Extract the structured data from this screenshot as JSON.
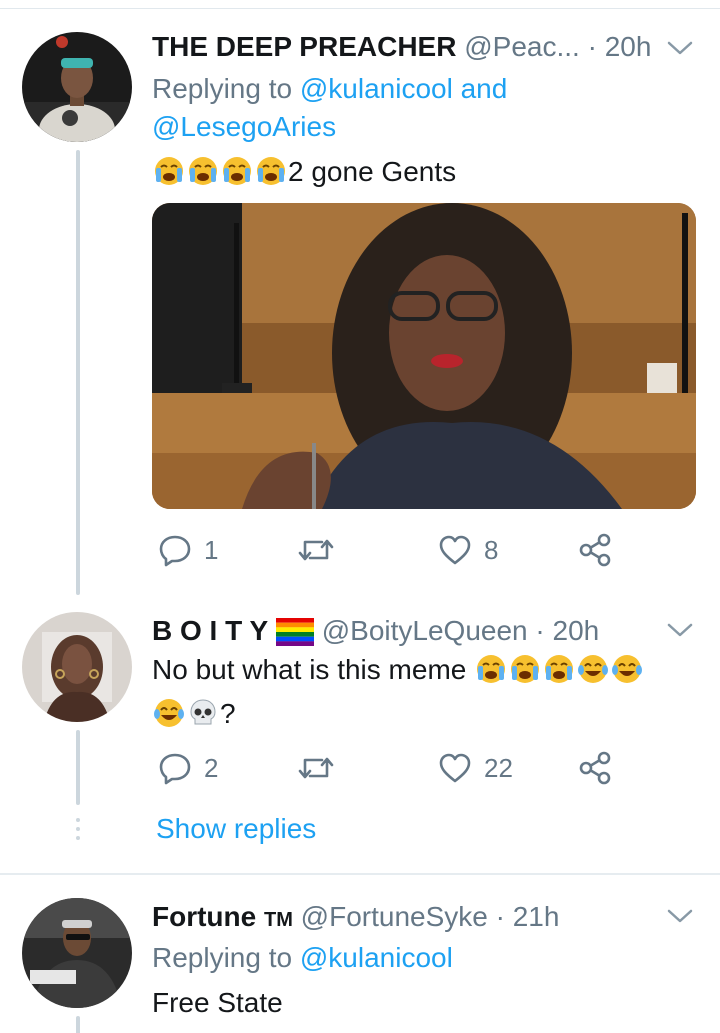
{
  "tweets": [
    {
      "name": "THE DEEP PREACHER",
      "handle": "@Peac...",
      "time": "· 20h",
      "reply_prefix": "Replying to ",
      "reply_mention_1": "@kulanicool",
      "reply_and": " and",
      "reply_mention_2": "@LesegoAries",
      "text": "2 gone Gents",
      "emojis": [
        "loudly-crying-face",
        "loudly-crying-face",
        "loudly-crying-face",
        "loudly-crying-face"
      ],
      "actions": {
        "replies": "1",
        "retweets": "",
        "likes": "8"
      }
    },
    {
      "name": "B O I T Y",
      "name_emoji": "rainbow-flag",
      "handle": "@BoityLeQueen",
      "time": "· 20h",
      "text_line1": "No but what is this meme",
      "text_line2_suffix": "?",
      "emojis_line1": [
        "loudly-crying-face",
        "loudly-crying-face",
        "loudly-crying-face",
        "face-with-tears-of-joy",
        "face-with-tears-of-joy"
      ],
      "emojis_line2": [
        "face-with-tears-of-joy",
        "skull"
      ],
      "actions": {
        "replies": "2",
        "retweets": "",
        "likes": "22"
      },
      "show_replies": "Show replies"
    },
    {
      "name": "Fortune",
      "name_suffix": "TM",
      "handle": "@FortuneSyke",
      "time": "· 21h",
      "reply_prefix": "Replying to ",
      "reply_mention_1": "@kulanicool",
      "text": "Free State"
    }
  ],
  "colors": {
    "link": "#1da1f2",
    "secondary": "#657786",
    "primary": "#14171a",
    "thread_line": "#ccd6dd"
  }
}
